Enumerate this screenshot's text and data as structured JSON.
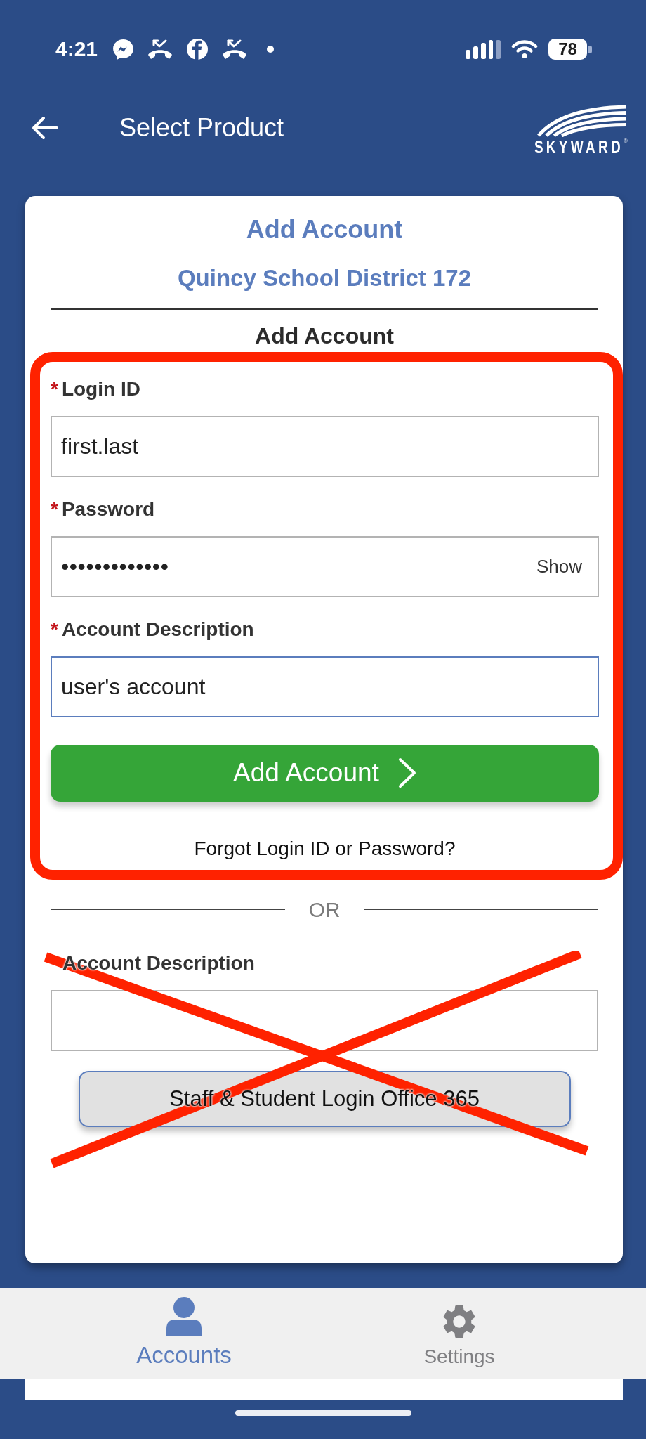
{
  "status_bar": {
    "time": "4:21",
    "battery": "78"
  },
  "header": {
    "title": "Select Product",
    "logo": {
      "text": "SKYWARD",
      "mark": "®"
    }
  },
  "card": {
    "title": "Add Account",
    "subtitle": "Quincy School District 172",
    "section_heading": "Add Account",
    "login_form": {
      "highlighted": true,
      "fields": [
        {
          "label": "Login ID",
          "required_mark": "*",
          "kind": "text",
          "value": "first.last",
          "focused": false
        },
        {
          "label": "Password",
          "required_mark": "*",
          "kind": "password",
          "value": "•••••••••••••",
          "reveal_button": "Show",
          "focused": false
        },
        {
          "label": "Account Description",
          "required_mark": "*",
          "kind": "text",
          "value": "user's account",
          "focused": true
        }
      ],
      "submit": "Add Account",
      "forgot_link": "Forgot Login ID or Password?"
    },
    "separator": "OR",
    "sso_form": {
      "crossed_out": true,
      "fields": [
        {
          "label": "Account Description",
          "kind": "text",
          "focused": false
        }
      ],
      "button": "Staff & Student Login Office 365"
    }
  },
  "tabs": [
    {
      "label": "Accounts",
      "selected": true
    },
    {
      "label": "Settings",
      "selected": false
    }
  ]
}
